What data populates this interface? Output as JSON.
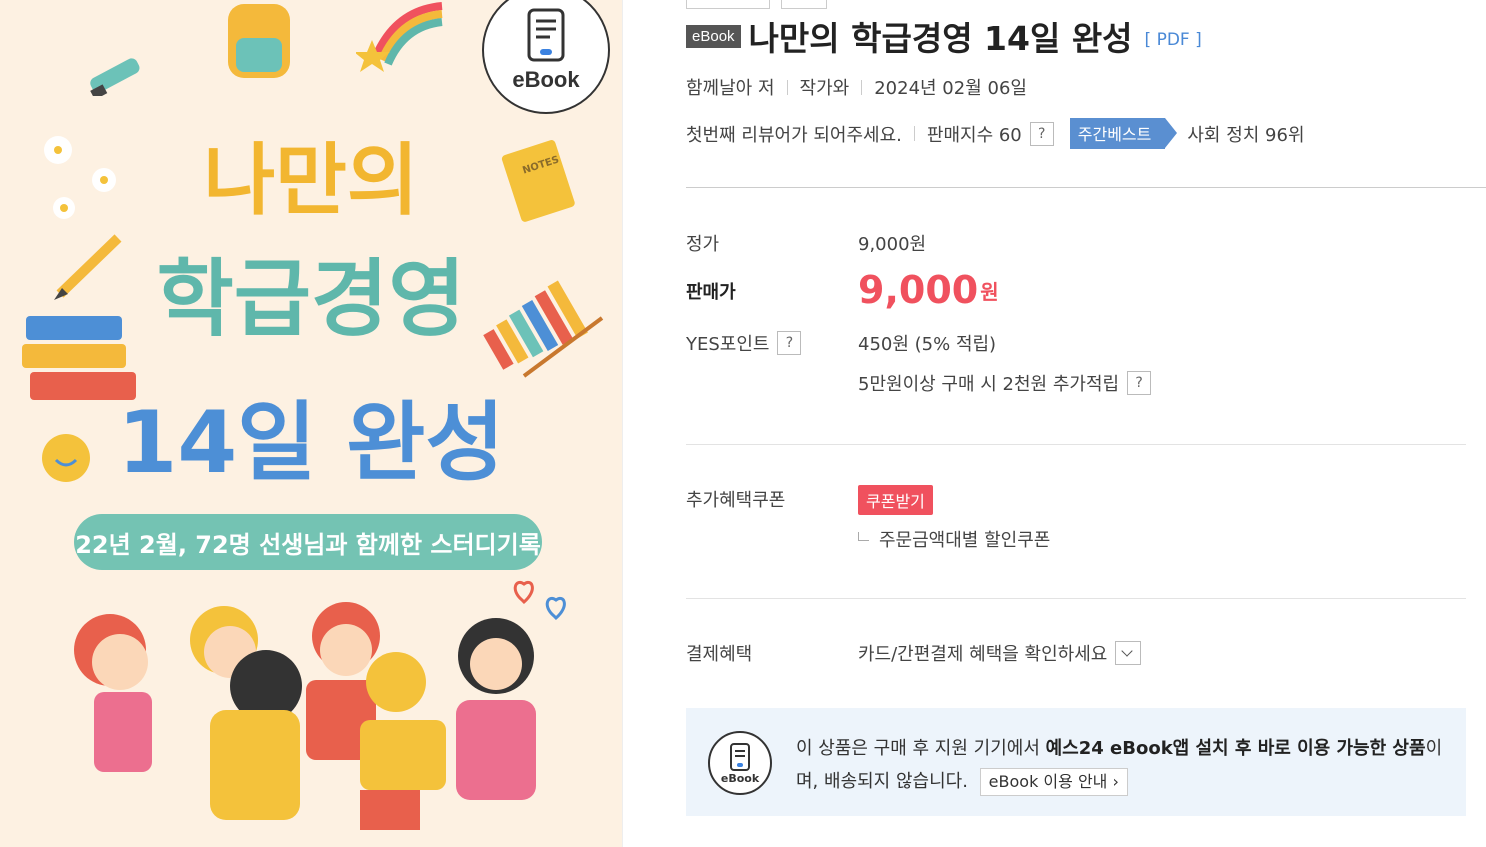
{
  "cover": {
    "badge_label": "eBook",
    "line1": "나만의",
    "line2": "학급경영",
    "line3": "14일 완성",
    "pill_text": "22년 2월, 72명 선생님과 함께한 스터디기록",
    "notes_label": "NOTES"
  },
  "product": {
    "tag": "eBook",
    "title": "나만의 학급경영 14일 완성",
    "format": "[ PDF ]",
    "author": "함께날아 저",
    "publisher": "작가와",
    "date": "2024년 02월 06일",
    "review_prompt": "첫번째 리뷰어가 되어주세요.",
    "sales_index": "판매지수 60",
    "weekly_best": "주간베스트",
    "rank": "사회 정치 96위"
  },
  "price": {
    "list_label": "정가",
    "list_value": "9,000원",
    "sale_label": "판매가",
    "sale_value": "9,000",
    "sale_unit": "원",
    "points_label": "YES포인트",
    "points_value": "450원 (5% 적립)",
    "points_extra": "5만원이상 구매 시 2천원 추가적립"
  },
  "coupon": {
    "label": "추가혜택쿠폰",
    "button": "쿠폰받기",
    "sub": "주문금액대별 할인쿠폰"
  },
  "payment": {
    "label": "결제혜택",
    "value": "카드/간편결제 혜택을 확인하세요"
  },
  "notice": {
    "icon_label": "eBook",
    "text1": "이 상품은 구매 후 지원 기기에서 ",
    "bold1": "예스24 eBook앱 설치 후 바로 이용 가능한 상품",
    "text2": "이며, 배송되지 않습니다.",
    "guide_button": "eBook 이용 안내"
  },
  "colors": {
    "accent_red": "#f0515e",
    "accent_blue": "#5a8fd1",
    "notice_bg": "#edf4fb"
  }
}
